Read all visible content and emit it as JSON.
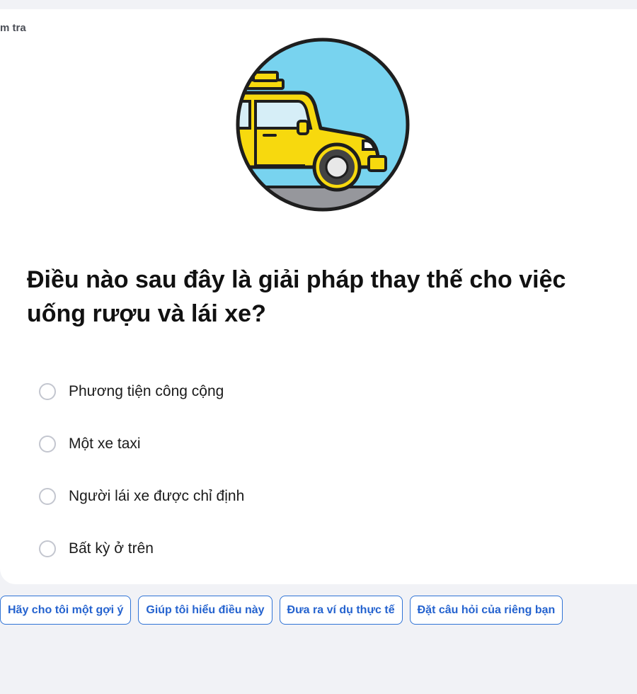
{
  "card": {
    "label_cut": "m tra"
  },
  "illustration": {
    "icon": "taxi-car-illustration"
  },
  "question": {
    "text": "Điều nào sau đây là giải pháp thay thế cho việc uống rượu và lái xe?"
  },
  "options": [
    {
      "label": "Phương tiện công cộng",
      "selected": false
    },
    {
      "label": "Một xe taxi",
      "selected": false
    },
    {
      "label": "Người lái xe được chỉ định",
      "selected": false
    },
    {
      "label": "Bất kỳ ở trên",
      "selected": false
    }
  ],
  "chips": [
    {
      "label": "Hãy cho tôi một gợi ý"
    },
    {
      "label": "Giúp tôi hiểu điều này"
    },
    {
      "label": "Đưa ra ví dụ thực tế"
    },
    {
      "label": "Đặt câu hỏi của riêng bạn"
    }
  ],
  "colors": {
    "accent": "#2563cf",
    "page_bg": "#f1f2f6",
    "taxi_yellow": "#f7d90e",
    "sky": "#78d3ef"
  }
}
